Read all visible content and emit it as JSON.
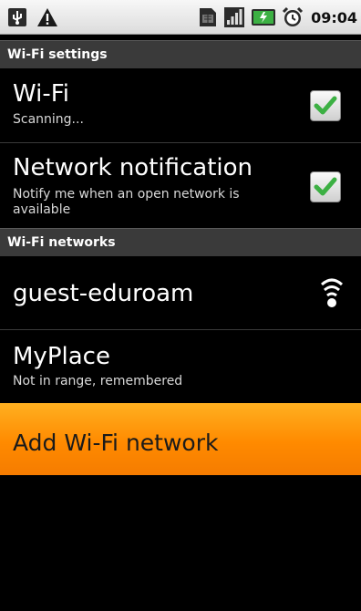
{
  "status_bar": {
    "time": "09:04",
    "icons": [
      "usb-icon",
      "warning-icon",
      "sim-icon",
      "signal-icon",
      "battery-icon",
      "alarm-icon"
    ]
  },
  "sections": {
    "wifi_settings": "Wi-Fi settings",
    "wifi_networks": "Wi-Fi networks"
  },
  "wifi": {
    "title": "Wi-Fi",
    "summary": "Scanning...",
    "checked": true
  },
  "network_notification": {
    "title": "Network notification",
    "summary": "Notify me when an open network is available",
    "checked": true
  },
  "networks": [
    {
      "name": "guest-eduroam",
      "summary": "",
      "signal_icon": "wifi-signal-icon"
    },
    {
      "name": "MyPlace",
      "summary": "Not in range, remembered"
    }
  ],
  "add_network": {
    "label": "Add Wi-Fi network"
  },
  "colors": {
    "highlight": "#ff9800",
    "check": "#3cb043",
    "background": "#000000",
    "section_header": "#3a3a3a"
  }
}
